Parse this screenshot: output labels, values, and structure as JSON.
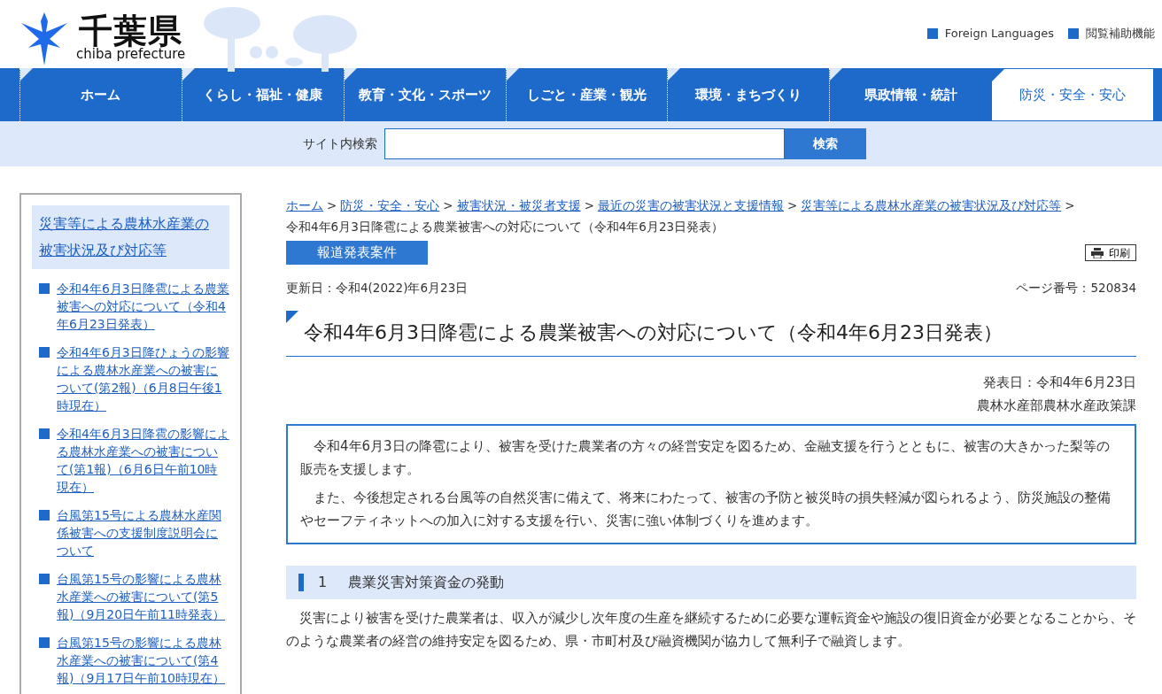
{
  "header": {
    "logo_title": "千葉県",
    "logo_subtitle": "chiba prefecture",
    "utility_links": [
      "Foreign Languages",
      "閲覧補助機能"
    ]
  },
  "nav": [
    {
      "label": "ホーム",
      "selected": false
    },
    {
      "label": "くらし・福祉・健康",
      "selected": false
    },
    {
      "label": "教育・文化・スポーツ",
      "selected": false
    },
    {
      "label": "しごと・産業・観光",
      "selected": false
    },
    {
      "label": "環境・まちづくり",
      "selected": false
    },
    {
      "label": "県政情報・統計",
      "selected": false
    },
    {
      "label": "防災・安全・安心",
      "selected": true
    }
  ],
  "search": {
    "label": "サイト内検索",
    "button": "検索"
  },
  "sidebar": {
    "heading": "災害等による農林水産業の被害状況及び対応等",
    "items": [
      "令和4年6月3日降雹による農業被害への対応について（令和4年6月23日発表）",
      "令和4年6月3日降ひょうの影響による農林水産業への被害について(第2報)（6月8日午後1時現在）",
      "令和4年6月3日降雹の影響による農林水産業への被害について(第1報)（6月6日午前10時現在）",
      "台風第15号による農林水産関係被害への支援制度説明会について",
      "台風第15号の影響による農林水産業への被害について(第5報)（9月20日午前11時発表）",
      "台風第15号の影響による農林水産業への被害について(第4報)（9月17日午前10時現在）"
    ]
  },
  "breadcrumb": {
    "links": [
      "ホーム",
      "防災・安全・安心",
      "被害状況・被災者支援",
      "最近の災害の被害状況と支援情報",
      "災害等による農林水産業の被害状況及び対応等"
    ],
    "separators": [
      ">",
      ">",
      ">",
      ">",
      ">"
    ],
    "current": "令和4年6月3日降雹による農業被害への対応について（令和4年6月23日発表）"
  },
  "category_tag": "報道発表案件",
  "print_button": "印刷",
  "updated": "更新日：令和4(2022)年6月23日",
  "page_number": "ページ番号：520834",
  "title": "令和4年6月3日降雹による農業被害への対応について（令和4年6月23日発表）",
  "announce_date": "発表日：令和4年6月23日",
  "department": "農林水産部農林水産政策課",
  "summary": [
    "令和4年6月3日の降雹により、被害を受けた農業者の方々の経営安定を図るため、金融支援を行うとともに、被害の大きかった梨等の販売を支援します。",
    "また、今後想定される台風等の自然災害に備えて、将来にわたって、被害の予防と被災時の損失軽減が図られるよう、防災施設の整備やセーフティネットへの加入に対する支援を行い、災害に強い体制づくりを進めます。"
  ],
  "section": {
    "number": "1",
    "heading": "農業災害対策資金の発動",
    "body": "災害により被害を受けた農業者は、収入が減少し次年度の生産を継続するために必要な運転資金や施設の復旧資金が必要となることから、そのような農業者の経営の維持安定を図るため、県・市町村及び融資機関が協力して無利子で融資します。"
  }
}
